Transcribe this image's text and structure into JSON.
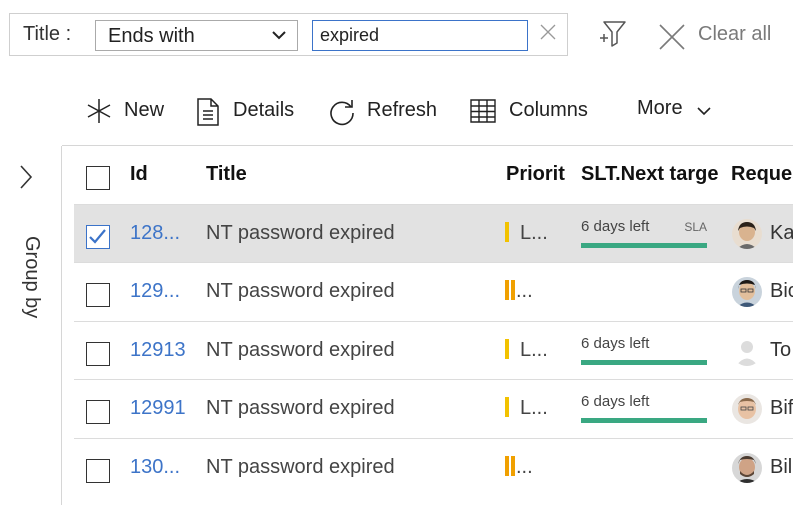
{
  "filter": {
    "label": "Title :",
    "operator": "Ends with",
    "value": "expired"
  },
  "toolbar": {
    "clear_all": "Clear all",
    "new": "New",
    "details": "Details",
    "refresh": "Refresh",
    "columns": "Columns",
    "more": "More"
  },
  "rail": {
    "label": "Group by"
  },
  "columns": {
    "id": "Id",
    "title": "Title",
    "priority": "Priorit",
    "sla": "SLT.Next targe",
    "requester": "Reques"
  },
  "rows": [
    {
      "id": "128...",
      "title": "NT password expired",
      "priority_text": "L...",
      "priority_color": "#f2c200",
      "sla": "6 days left",
      "sla_tag": "SLA",
      "requester": "Ka",
      "selected": true
    },
    {
      "id": "129...",
      "title": "NT password expired",
      "priority_text": "...",
      "priority_color": "#f0a000",
      "sla": "",
      "sla_tag": "",
      "requester": "Bic",
      "selected": false
    },
    {
      "id": "12913",
      "title": "NT password expired",
      "priority_text": "L...",
      "priority_color": "#f2c200",
      "sla": "6 days left",
      "sla_tag": "",
      "requester": "To",
      "selected": false
    },
    {
      "id": "12991",
      "title": "NT password expired",
      "priority_text": "L...",
      "priority_color": "#f2c200",
      "sla": "6 days left",
      "sla_tag": "",
      "requester": "Bif",
      "selected": false
    },
    {
      "id": "130...",
      "title": "NT password expired",
      "priority_text": "...",
      "priority_color": "#f0a000",
      "sla": "",
      "sla_tag": "",
      "requester": "Bil",
      "selected": false
    }
  ]
}
